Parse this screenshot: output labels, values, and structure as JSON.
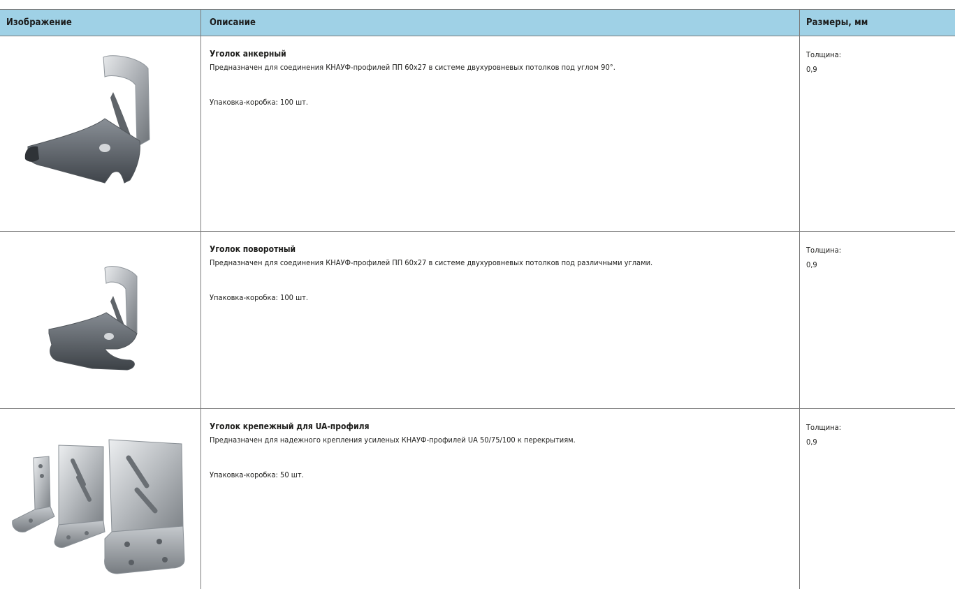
{
  "table": {
    "headers": {
      "image": "Изображение",
      "description": "Описание",
      "sizes": "Размеры, мм"
    },
    "rows": [
      {
        "name": "Уголок анкерный",
        "description": "Предназначен для соединения КНАУФ-профилей ПП 60х27 в системе двухуровневых потолков под углом 90°.",
        "packaging": "Упаковка-коробка: 100 шт.",
        "thickness_label": "Толщина:",
        "thickness_value": "0,9",
        "image_icon": "anchor-angle-bracket-photo"
      },
      {
        "name": "Уголок поворотный",
        "description": "Предназначен для соединения КНАУФ-профилей ПП 60х27 в системе двухуровневых потолков под различными углами.",
        "packaging": "Упаковка-коробка: 100 шт.",
        "thickness_label": "Толщина:",
        "thickness_value": "0,9",
        "image_icon": "rotary-angle-bracket-photo"
      },
      {
        "name": "Уголок крепежный для UA-профиля",
        "description": "Предназначен для надежного крепления усиленых КНАУФ-профилей UA 50/75/100 к перекрытиям.",
        "packaging": "Упаковка-коробка: 50 шт.",
        "thickness_label": "Толщина:",
        "thickness_value": "0,9",
        "image_icon": "ua-profile-bracket-photo"
      }
    ]
  },
  "colors": {
    "header_bg": "#9fd1e6",
    "border": "#7a7a7a",
    "text": "#1d1d1b"
  }
}
